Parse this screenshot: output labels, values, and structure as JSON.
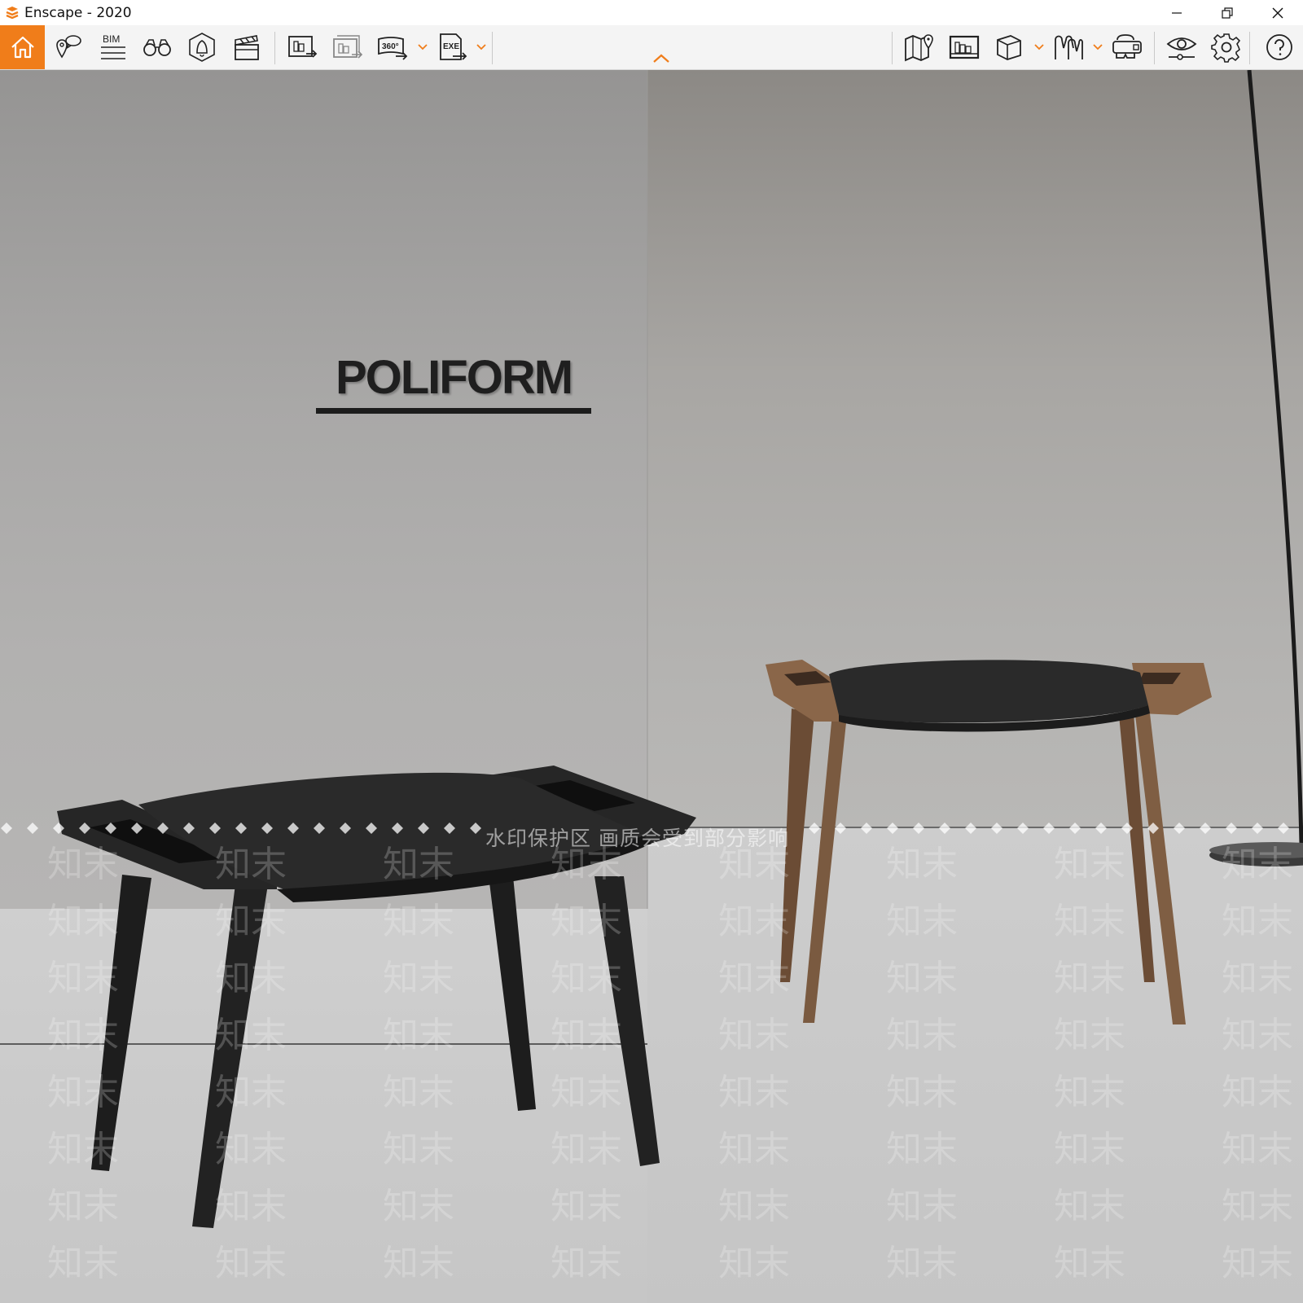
{
  "window": {
    "title": "Enscape - 2020",
    "controls": [
      "minimize-icon",
      "restore-icon",
      "close-icon"
    ]
  },
  "toolbar": {
    "accent_color": "#f07d1a",
    "left_tools": [
      {
        "name": "home",
        "icon": "home-icon"
      },
      {
        "name": "views",
        "icon": "views-icon"
      },
      {
        "name": "bim",
        "icon": "bim-icon",
        "label": "BIM"
      },
      {
        "name": "binoculars",
        "icon": "binoculars-icon"
      },
      {
        "name": "sound",
        "icon": "sound-icon"
      },
      {
        "name": "video-editor",
        "icon": "clapperboard-icon"
      },
      {
        "name": "screenshot",
        "icon": "render-export-icon"
      },
      {
        "name": "batch-render",
        "icon": "batch-render-icon"
      },
      {
        "name": "panorama",
        "icon": "panorama-icon",
        "label": "360°"
      },
      {
        "name": "exe-export",
        "icon": "exe-export-icon",
        "label": "EXE"
      }
    ],
    "right_tools": [
      {
        "name": "map",
        "icon": "map-icon"
      },
      {
        "name": "asset-library",
        "icon": "asset-library-icon"
      },
      {
        "name": "material",
        "icon": "cube-icon"
      },
      {
        "name": "walk",
        "icon": "walk-icon"
      },
      {
        "name": "vr",
        "icon": "vr-headset-icon"
      },
      {
        "name": "visual-settings",
        "icon": "eye-icon"
      },
      {
        "name": "settings",
        "icon": "gear-icon"
      },
      {
        "name": "help",
        "icon": "help-icon"
      }
    ]
  },
  "viewport": {
    "brand": "POLIFORM",
    "watermark_notice": "水印保护区  画质会受到部分影响",
    "watermark_tile": "知末"
  }
}
